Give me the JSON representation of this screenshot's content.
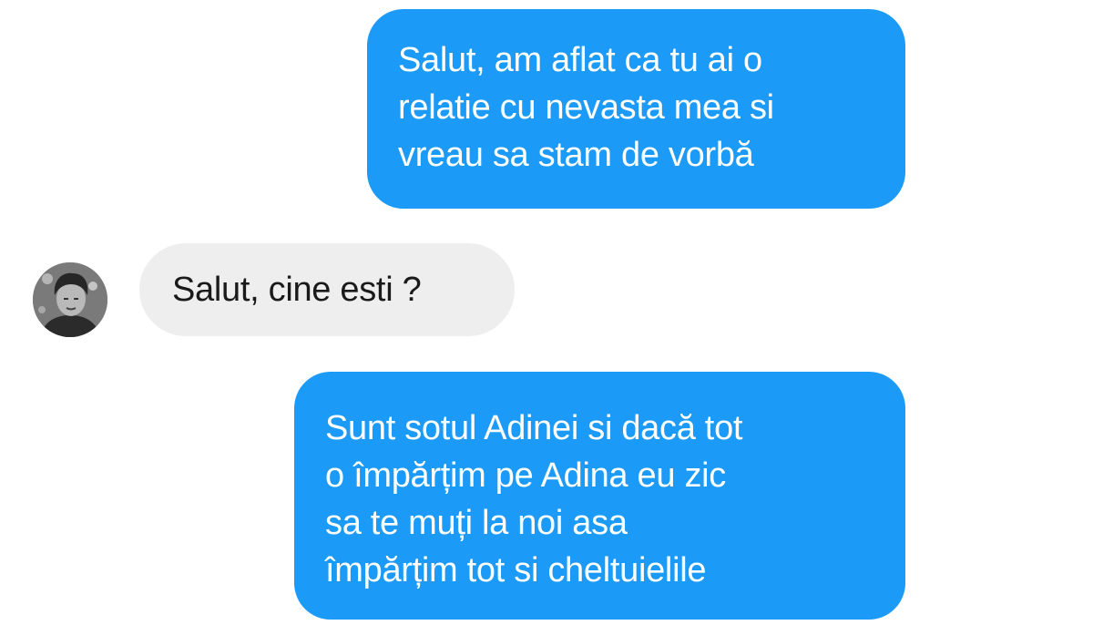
{
  "conversation": {
    "messages": [
      {
        "direction": "sent",
        "lines": [
          "Salut, am aflat ca tu ai o",
          "relatie cu nevasta mea si",
          "vreau sa stam de vorbă"
        ]
      },
      {
        "direction": "received",
        "lines": [
          "Salut, cine esti ?"
        ]
      },
      {
        "direction": "sent",
        "lines": [
          "Sunt sotul Adinei si dacă tot",
          "o împărțim pe Adina eu zic",
          "sa te muți la noi asa",
          "împărțim tot si cheltuielile"
        ]
      }
    ]
  },
  "colors": {
    "sent_bubble": "#1b9af7",
    "received_bubble": "#eeeeee",
    "background": "#ffffff"
  },
  "icons": {
    "avatar": "contact-avatar"
  }
}
